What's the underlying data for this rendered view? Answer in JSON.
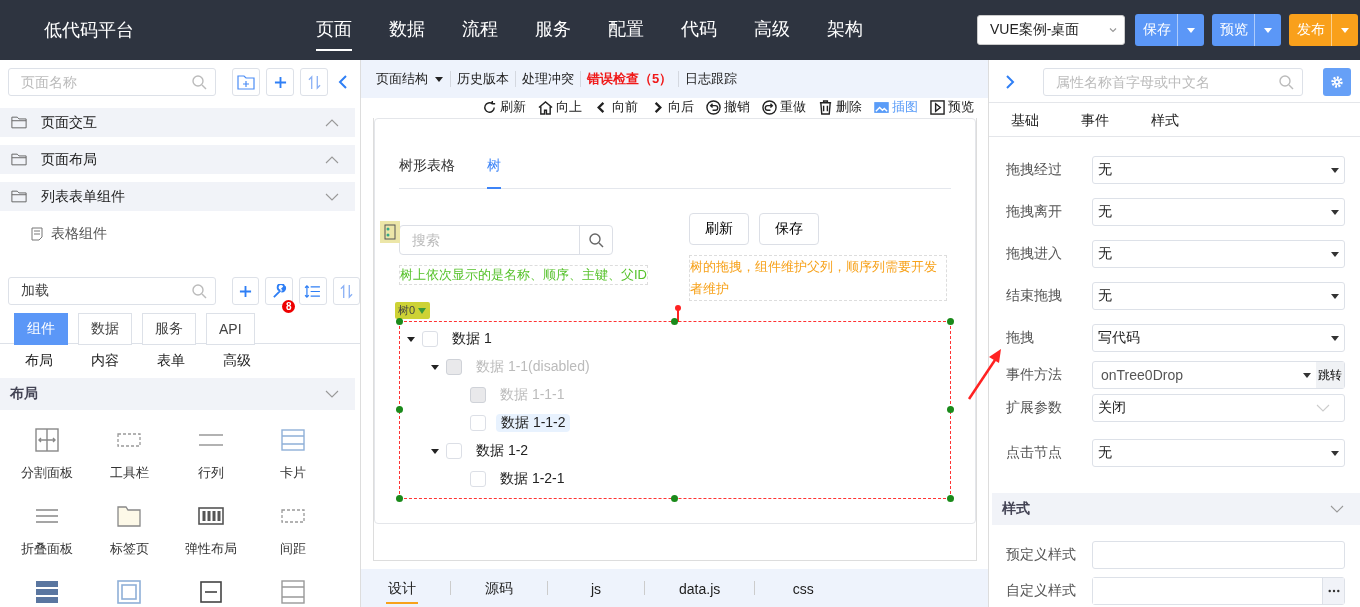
{
  "header": {
    "title": "低代码平台",
    "nav": [
      {
        "label": "页面",
        "selected": true
      },
      {
        "label": "数据",
        "selected": false
      },
      {
        "label": "流程",
        "selected": false
      },
      {
        "label": "服务",
        "selected": false
      },
      {
        "label": "配置",
        "selected": false
      },
      {
        "label": "代码",
        "selected": false
      },
      {
        "label": "高级",
        "selected": false
      },
      {
        "label": "架构",
        "selected": false
      }
    ],
    "project_select": "VUE案例-桌面",
    "buttons": [
      {
        "label": "保存",
        "kind": "primary"
      },
      {
        "label": "预览",
        "kind": "primary"
      },
      {
        "label": "发布",
        "kind": "warning"
      }
    ]
  },
  "left_panel": {
    "page_search": {
      "placeholder": "页面名称"
    },
    "page_groups": [
      {
        "label": "页面交互",
        "expanded": false
      },
      {
        "label": "页面布局",
        "expanded": false
      },
      {
        "label": "列表表单组件",
        "expanded": true,
        "children": [
          {
            "label": "表格组件"
          }
        ]
      }
    ],
    "component_search": {
      "value": "加载"
    },
    "tool_badge": "8",
    "tabs": [
      {
        "label": "组件",
        "selected": true
      },
      {
        "label": "数据",
        "selected": false
      },
      {
        "label": "服务",
        "selected": false
      },
      {
        "label": "API",
        "selected": false
      }
    ],
    "subtabs": [
      "布局",
      "内容",
      "表单",
      "高级"
    ],
    "section": {
      "title": "布局",
      "components": [
        "分割面板",
        "工具栏",
        "行列",
        "卡片",
        "折叠面板",
        "标签页",
        "弹性布局",
        "间距"
      ]
    }
  },
  "toolbar": [
    {
      "label": "页面结构",
      "kind": "menu"
    },
    {
      "label": "历史版本",
      "kind": "link"
    },
    {
      "label": "处理冲突",
      "kind": "link"
    },
    {
      "label": "错误检查（5）",
      "kind": "error"
    },
    {
      "label": "日志跟踪",
      "kind": "link"
    }
  ],
  "actions": [
    {
      "label": "刷新",
      "selected": false
    },
    {
      "label": "向上",
      "selected": false
    },
    {
      "label": "向前",
      "selected": false
    },
    {
      "label": "向后",
      "selected": false
    },
    {
      "label": "撤销",
      "selected": false
    },
    {
      "label": "重做",
      "selected": false
    },
    {
      "label": "删除",
      "selected": false
    },
    {
      "label": "插图",
      "selected": true
    },
    {
      "label": "预览",
      "selected": false
    }
  ],
  "canvas": {
    "tabs": [
      {
        "label": "树形表格",
        "selected": false
      },
      {
        "label": "树",
        "selected": true
      }
    ],
    "search": {
      "placeholder": "搜索"
    },
    "buttons": [
      "刷新",
      "保存"
    ],
    "hint": "树上依次显示的是名称、顺序、主键、父ID",
    "drag_note": "树的拖拽，组件维护父列，顺序列需要开发者维护",
    "component_tag": "树0",
    "tree": [
      {
        "label": "数据 1",
        "checked": false,
        "disabled": false,
        "selected": false,
        "expanded": true,
        "children": [
          {
            "label": "数据 1-1(disabled)",
            "checked": false,
            "disabled": true,
            "selected": false,
            "expanded": true,
            "children": [
              {
                "label": "数据 1-1-1",
                "checked": false,
                "disabled": true,
                "selected": false
              },
              {
                "label": "数据 1-1-2",
                "checked": false,
                "disabled": false,
                "selected": true
              }
            ]
          },
          {
            "label": "数据 1-2",
            "checked": false,
            "disabled": false,
            "selected": false,
            "expanded": true,
            "children": [
              {
                "label": "数据 1-2-1",
                "checked": false,
                "disabled": false,
                "selected": false
              }
            ]
          }
        ]
      }
    ]
  },
  "bottom_tabs": [
    {
      "label": "设计",
      "selected": true
    },
    {
      "label": "源码",
      "selected": false
    },
    {
      "label": "js",
      "selected": false
    },
    {
      "label": "data.js",
      "selected": false
    },
    {
      "label": "css",
      "selected": false
    }
  ],
  "properties": {
    "search": {
      "placeholder": "属性名称首字母或中文名"
    },
    "tabs": [
      "基础",
      "事件",
      "样式"
    ],
    "rows": [
      {
        "label": "拖拽经过",
        "value": "无",
        "kind": "dropdown"
      },
      {
        "label": "拖拽离开",
        "value": "无",
        "kind": "dropdown"
      },
      {
        "label": "拖拽进入",
        "value": "无",
        "kind": "dropdown"
      },
      {
        "label": "结束拖拽",
        "value": "无",
        "kind": "dropdown"
      },
      {
        "label": "拖拽",
        "value": "写代码",
        "kind": "dropdown"
      },
      {
        "label": "事件方法",
        "value": "onTree0Drop",
        "kind": "method",
        "button": "跳转"
      },
      {
        "label": "扩展参数",
        "value": "关闭",
        "kind": "switch"
      },
      {
        "label": "点击节点",
        "value": "无",
        "kind": "dropdown"
      }
    ],
    "style_section": {
      "title": "样式",
      "rows": [
        {
          "label": "预定义样式",
          "kind": "text"
        },
        {
          "label": "自定义样式",
          "kind": "editor"
        }
      ]
    }
  }
}
